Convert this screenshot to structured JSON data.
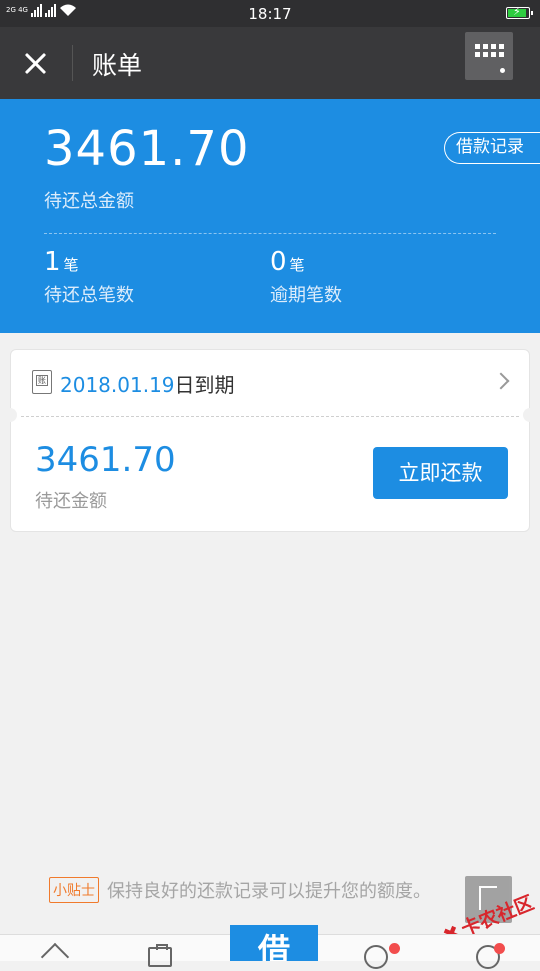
{
  "status_bar": {
    "network": "2G 4G",
    "time": "18:17"
  },
  "header": {
    "title": "账单"
  },
  "summary": {
    "total_amount": "3461.70",
    "total_label": "待还总金额",
    "history_button": "借款记录",
    "pending_count": "1",
    "pending_unit": "笔",
    "pending_label": "待还总笔数",
    "overdue_count": "0",
    "overdue_unit": "笔",
    "overdue_label": "逾期笔数"
  },
  "bill": {
    "due_date": "2018.01.19",
    "due_suffix": "日到期",
    "bill_icon_char": "账",
    "amount": "3461.70",
    "amount_label": "待还金额",
    "pay_button": "立即还款"
  },
  "tip": {
    "badge": "小贴士",
    "text": "保持良好的还款记录可以提升您的额度。"
  },
  "watermark": {
    "text": "卡农社区"
  },
  "bottom_nav": {
    "borrow_label": "借"
  },
  "colors": {
    "brand_blue": "#1d8de2",
    "header_dark": "#39393b",
    "tip_orange": "#f07a2c",
    "badge_red": "#f24d4d"
  }
}
